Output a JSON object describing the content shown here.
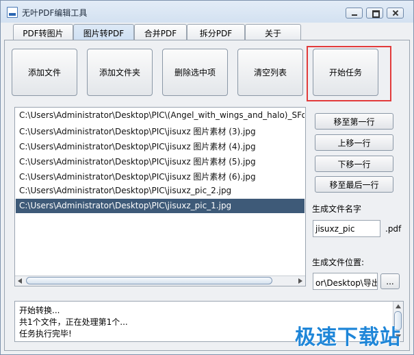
{
  "window": {
    "title": "无叶PDF编辑工具",
    "icon": "pdf-app-icon"
  },
  "tabs": [
    {
      "label": "PDF转图片",
      "active": false
    },
    {
      "label": "图片转PDF",
      "active": true
    },
    {
      "label": "合并PDF",
      "active": false
    },
    {
      "label": "拆分PDF",
      "active": false
    },
    {
      "label": "关于",
      "active": false
    }
  ],
  "toolbar": {
    "add_file": "添加文件",
    "add_folder": "添加文件夹",
    "delete_selected": "删除选中项",
    "clear_list": "清空列表",
    "start_task": "开始任务"
  },
  "highlight_color": "#e23a3a",
  "files": [
    "C:\\Users\\Administrator\\Desktop\\PIC\\(Angel_with_wings_and_halo)_SFont.C",
    "C:\\Users\\Administrator\\Desktop\\PIC\\jisuxz 图片素材 (3).jpg",
    "C:\\Users\\Administrator\\Desktop\\PIC\\jisuxz 图片素材 (4).jpg",
    "C:\\Users\\Administrator\\Desktop\\PIC\\jisuxz 图片素材 (5).jpg",
    "C:\\Users\\Administrator\\Desktop\\PIC\\jisuxz 图片素材 (6).jpg",
    "C:\\Users\\Administrator\\Desktop\\PIC\\jisuxz_pic_2.jpg",
    "C:\\Users\\Administrator\\Desktop\\PIC\\jisuxz_pic_1.jpg"
  ],
  "selected_file_index": 6,
  "side": {
    "move_top": "移至第一行",
    "move_up": "上移一行",
    "move_down": "下移一行",
    "move_bottom": "移至最后一行",
    "output_name_label": "生成文件名字",
    "output_name_value": "jisuxz_pic",
    "output_ext": ".pdf",
    "output_location_label": "生成文件位置:",
    "output_location_value": "or\\Desktop\\导出",
    "browse": "..."
  },
  "log": [
    "开始转换...",
    "共1个文件，正在处理第1个...",
    "任务执行完毕!"
  ],
  "watermark": "极速下载站"
}
